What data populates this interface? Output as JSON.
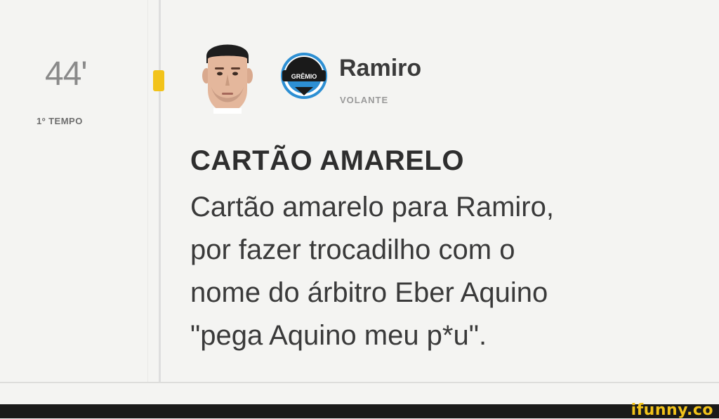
{
  "match": {
    "minute": "44'",
    "period": "1º TEMPO"
  },
  "player": {
    "name": "Ramiro",
    "position": "VOLANTE",
    "club_crest": "GRÊMIO"
  },
  "event": {
    "title": "CARTÃO AMARELO",
    "description_lines": [
      "Cartão amarelo para Ramiro,",
      "por fazer trocadilho com o",
      "nome do árbitro Eber Aquino",
      "\"pega Aquino meu p*u\"."
    ]
  },
  "colors": {
    "yellow_card": "#f2c31a",
    "crest_blue": "#2d8fd3",
    "background": "#f4f4f2"
  },
  "icons": {
    "event_marker": "yellow-card-icon",
    "avatar": "player-avatar",
    "crest": "club-crest-icon"
  },
  "watermark": "ifunny.co"
}
